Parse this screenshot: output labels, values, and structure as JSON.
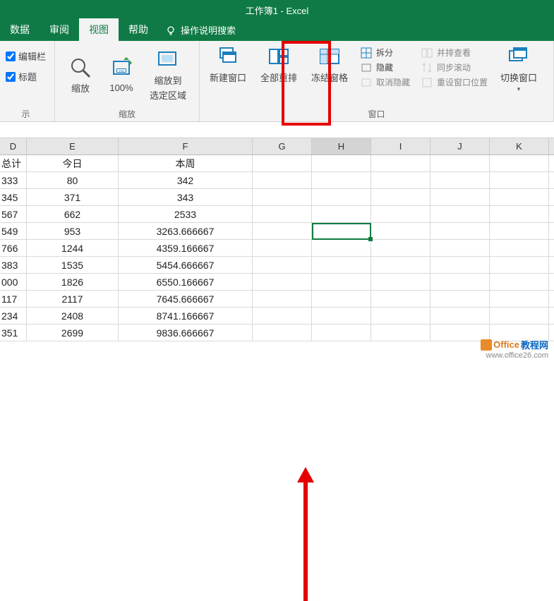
{
  "title": "工作簿1 - Excel",
  "tabs": {
    "data": "数据",
    "review": "审阅",
    "view": "视图",
    "help": "帮助",
    "tellme": "操作说明搜索"
  },
  "ribbon": {
    "show": {
      "formula_bar": "编辑栏",
      "headings": "标题",
      "group_label": "示"
    },
    "zoom": {
      "zoom": "缩放",
      "hundred": "100%",
      "to_selection_l1": "缩放到",
      "to_selection_l2": "选定区域",
      "group_label": "缩放"
    },
    "window": {
      "new_window": "新建窗口",
      "arrange_all": "全部重排",
      "freeze_panes": "冻结窗格",
      "split": "拆分",
      "hide": "隐藏",
      "unhide": "取消隐藏",
      "side_by_side": "并排查看",
      "sync_scroll": "同步滚动",
      "reset_pos": "重设窗口位置",
      "switch": "切换窗口",
      "group_label": "窗口"
    }
  },
  "columns": [
    "D",
    "E",
    "F",
    "G",
    "H",
    "I",
    "J",
    "K"
  ],
  "rows": [
    {
      "d": "总计",
      "e": "今日",
      "f": "本周"
    },
    {
      "d": "333",
      "e": "80",
      "f": "342"
    },
    {
      "d": "345",
      "e": "371",
      "f": "343"
    },
    {
      "d": "567",
      "e": "662",
      "f": "2533"
    },
    {
      "d": "549",
      "e": "953",
      "f": "3263.666667"
    },
    {
      "d": "766",
      "e": "1244",
      "f": "4359.166667"
    },
    {
      "d": "383",
      "e": "1535",
      "f": "5454.666667"
    },
    {
      "d": "000",
      "e": "1826",
      "f": "6550.166667"
    },
    {
      "d": "117",
      "e": "2117",
      "f": "7645.666667"
    },
    {
      "d": "234",
      "e": "2408",
      "f": "8741.166667"
    },
    {
      "d": "351",
      "e": "2699",
      "f": "9836.666667"
    }
  ],
  "watermark": {
    "line1a": "Office",
    "line1b": "教程网",
    "line2": "www.office26.com"
  }
}
